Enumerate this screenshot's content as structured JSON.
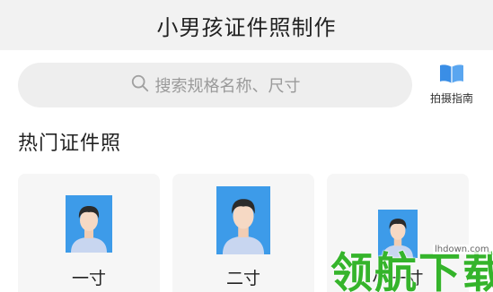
{
  "header": {
    "title": "小男孩证件照制作"
  },
  "search": {
    "placeholder": "搜索规格名称、尺寸",
    "icon": "search-icon"
  },
  "guide": {
    "label": "拍摄指南",
    "icon": "book-icon",
    "color": "#3a8ee6"
  },
  "section": {
    "title": "热门证件照"
  },
  "cards": [
    {
      "label": "一寸"
    },
    {
      "label": "二寸"
    },
    {
      "label": "小一寸"
    }
  ],
  "photo_colors": {
    "background": "#3d9be9",
    "shirt": "#c8d6f0",
    "hair": "#2b2b2b",
    "skin": "#f6d9c4"
  },
  "watermark": {
    "text": "领航下载",
    "url": "lhdown.com",
    "color": "#35b42b"
  }
}
